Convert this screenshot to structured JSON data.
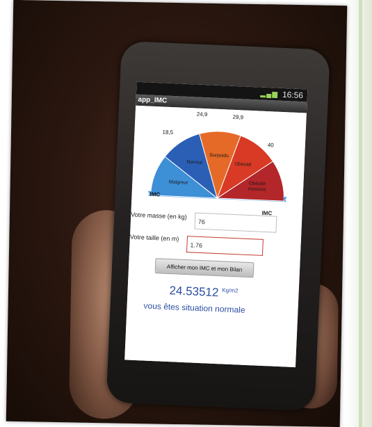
{
  "app": {
    "title": "app_IMC",
    "status_time": "16:56"
  },
  "gauge": {
    "thresholds": [
      "18,5",
      "24,9",
      "29,9",
      "40"
    ],
    "segments": [
      {
        "label": "Maigreur",
        "color": "#3d8fd6"
      },
      {
        "label": "Normal",
        "color": "#2a5fb5"
      },
      {
        "label": "Surpoids",
        "color": "#e56a27"
      },
      {
        "label": "Obésité",
        "color": "#d83a25"
      },
      {
        "label": "Obésité massive",
        "color": "#b3262a"
      }
    ],
    "axis_left_label": "IMC",
    "axis_right_label": "IMC"
  },
  "form": {
    "mass_label": "Votre masse (en kg)",
    "mass_value": "76",
    "height_label": "Votre taille (en m)",
    "height_value": "1.76",
    "button_label": "Afficher mon IMC et mon Bilan"
  },
  "result": {
    "bmi_value": "24.53512",
    "bmi_unit": "Kg/m2",
    "message": "vous êtes situation normale"
  }
}
